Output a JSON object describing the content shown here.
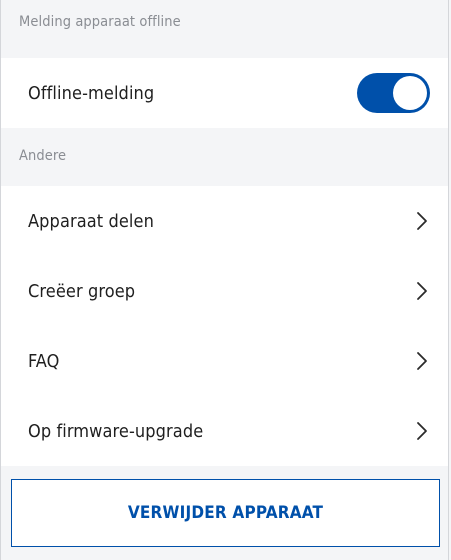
{
  "offline_section": {
    "header": "Melding apparaat offline",
    "toggle_label": "Offline-melding",
    "toggle_on": true
  },
  "other_section": {
    "header": "Andere",
    "items": [
      {
        "label": "Apparaat delen",
        "icon": "chevron-right-icon"
      },
      {
        "label": "Creëer groep",
        "icon": "chevron-right-icon"
      },
      {
        "label": "FAQ",
        "icon": "chevron-right-icon"
      },
      {
        "label": "Op firmware-upgrade",
        "icon": "chevron-right-icon"
      }
    ]
  },
  "delete_button": {
    "label": "VERWIJDER APPARAAT"
  },
  "colors": {
    "accent": "#0050aa",
    "background": "#f4f5f7",
    "row": "#ffffff",
    "header_text": "#8a8d93"
  }
}
